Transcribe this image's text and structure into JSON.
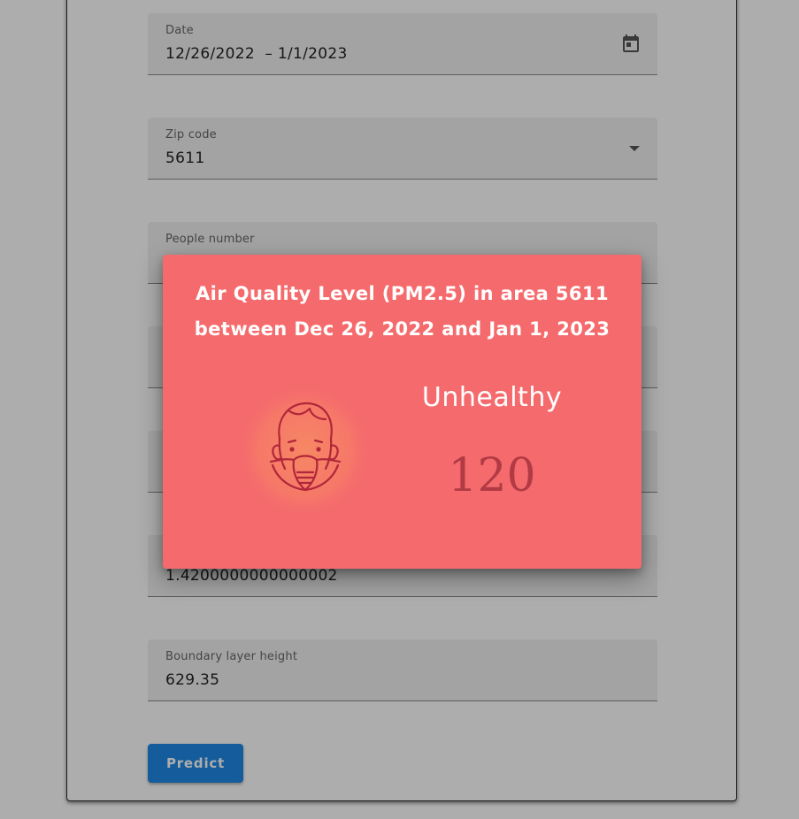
{
  "form": {
    "date": {
      "label": "Date",
      "value": "12/26/2022  – 1/1/2023",
      "icon": "calendar-icon"
    },
    "zip": {
      "label": "Zip code",
      "value": "5611",
      "icon": "dropdown-arrow-icon"
    },
    "people": {
      "label": "People number",
      "value": ""
    },
    "hidden_field_1": {
      "label": "",
      "value": ""
    },
    "hidden_field_2": {
      "label": "",
      "value": ""
    },
    "field_6": {
      "label": "",
      "value": "1.4200000000000002"
    },
    "boundary": {
      "label": "Boundary layer height",
      "value": "629.35"
    },
    "predict_label": "Predict"
  },
  "dialog": {
    "title_line1": "Air Quality Level (PM2.5) in area 5611",
    "title_line2": "between Dec 26, 2022 and Jan 1, 2023",
    "level_label": "Unhealthy",
    "level_value": "120",
    "icon": "face-mask-icon"
  },
  "colors": {
    "dialog_bg": "#f56b6d",
    "value_color": "#b23a44",
    "button_bg": "#1e88e5",
    "field_bg": "#f0f0f0"
  }
}
